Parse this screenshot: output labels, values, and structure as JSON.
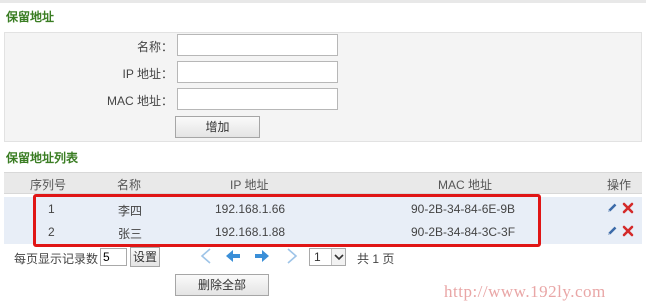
{
  "reserve_section": {
    "title": "保留地址",
    "fields": [
      {
        "label": "名称：",
        "value": "",
        "placeholder": ""
      },
      {
        "label": "IP 地址：",
        "value": "",
        "placeholder": ""
      },
      {
        "label": "MAC 地址：",
        "value": "",
        "placeholder": ""
      }
    ],
    "add_button": "增加"
  },
  "list_section": {
    "title": "保留地址列表",
    "columns": [
      "序列号",
      "名称",
      "IP 地址",
      "MAC 地址",
      "操作"
    ],
    "rows": [
      {
        "index": "1",
        "name": "李四",
        "ip": "192.168.1.66",
        "mac": "90-2B-34-84-6E-9B"
      },
      {
        "index": "2",
        "name": "张三",
        "ip": "192.168.1.88",
        "mac": "90-2B-34-84-3C-3F"
      }
    ]
  },
  "pager": {
    "per_page_label": "每页显示记录数",
    "per_page_value": "5",
    "set_button": "设置",
    "current_page": "1",
    "total_text": "共 1 页",
    "delete_all_button": "删除全部"
  },
  "watermark": "http://www.192ly.com",
  "colors": {
    "section_title": "#3a7d23",
    "highlight": "#e01515",
    "row_bg": "#e8eef7",
    "nav_arrow": "#3a8fd8",
    "delete_icon": "#d42a2a",
    "edit_icon": "#3b6aa8"
  }
}
